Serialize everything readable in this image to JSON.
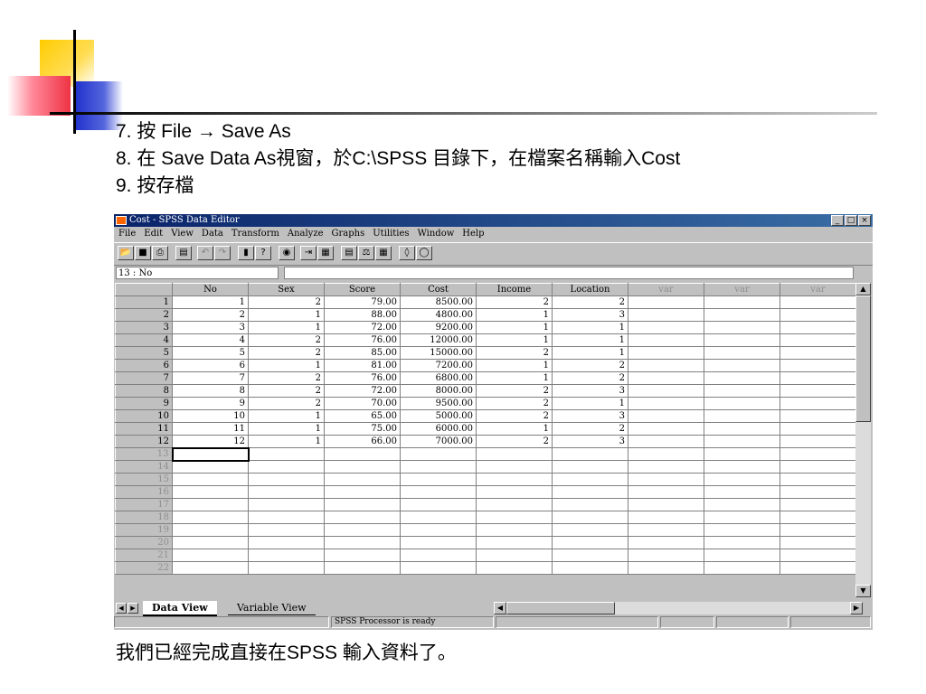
{
  "slide": {
    "steps": [
      "7. 按 File → Save As",
      "8. 在 Save Data As視窗，於C:\\SPSS 目錄下，在檔案名稱輸入Cost",
      "9. 按存檔"
    ],
    "footer": "我們已經完成直接在SPSS 輸入資料了。"
  },
  "window": {
    "title": "Cost - SPSS Data Editor",
    "controls": [
      "_",
      "□",
      "×"
    ],
    "menus": [
      "File",
      "Edit",
      "View",
      "Data",
      "Transform",
      "Analyze",
      "Graphs",
      "Utilities",
      "Window",
      "Help"
    ],
    "toolbar_icons": [
      "open-icon",
      "save-icon",
      "print-icon",
      "dialog-recall-icon",
      "undo-icon",
      "redo-icon",
      "goto-chart-icon",
      "goto-case-icon",
      "variables-icon",
      "find-icon",
      "insert-case-icon",
      "insert-variable-icon",
      "split-file-icon",
      "weight-cases-icon",
      "select-cases-icon",
      "value-labels-icon",
      "use-sets-icon"
    ],
    "cell_reference": "13 : No",
    "cell_editor_value": ""
  },
  "grid": {
    "columns": [
      "No",
      "Sex",
      "Score",
      "Cost",
      "Income",
      "Location",
      "var",
      "var",
      "var"
    ],
    "rows": [
      [
        "1",
        "2",
        "79.00",
        "8500.00",
        "2",
        "2"
      ],
      [
        "2",
        "1",
        "88.00",
        "4800.00",
        "1",
        "3"
      ],
      [
        "3",
        "1",
        "72.00",
        "9200.00",
        "1",
        "1"
      ],
      [
        "4",
        "2",
        "76.00",
        "12000.00",
        "1",
        "1"
      ],
      [
        "5",
        "2",
        "85.00",
        "15000.00",
        "2",
        "1"
      ],
      [
        "6",
        "1",
        "81.00",
        "7200.00",
        "1",
        "2"
      ],
      [
        "7",
        "2",
        "76.00",
        "6800.00",
        "1",
        "2"
      ],
      [
        "8",
        "2",
        "72.00",
        "8000.00",
        "2",
        "3"
      ],
      [
        "9",
        "2",
        "70.00",
        "9500.00",
        "2",
        "1"
      ],
      [
        "10",
        "1",
        "65.00",
        "5000.00",
        "2",
        "3"
      ],
      [
        "11",
        "1",
        "75.00",
        "6000.00",
        "1",
        "2"
      ],
      [
        "12",
        "1",
        "66.00",
        "7000.00",
        "2",
        "3"
      ]
    ],
    "row_numbers": [
      "1",
      "2",
      "3",
      "4",
      "5",
      "6",
      "7",
      "8",
      "9",
      "10",
      "11",
      "12",
      "13",
      "14",
      "15",
      "16",
      "17",
      "18",
      "19",
      "20",
      "21",
      "22"
    ],
    "active_row": 13
  },
  "tabs": [
    {
      "label": "Data View",
      "active": true
    },
    {
      "label": "Variable View",
      "active": false
    }
  ],
  "status": {
    "message": "SPSS Processor  is ready"
  },
  "colors": {
    "title_bar": "#0a246a",
    "chrome": "#c0c0c0",
    "deco_yellow": "#ffcc00",
    "deco_blue": "#2233cc",
    "deco_red": "#ee3344"
  }
}
